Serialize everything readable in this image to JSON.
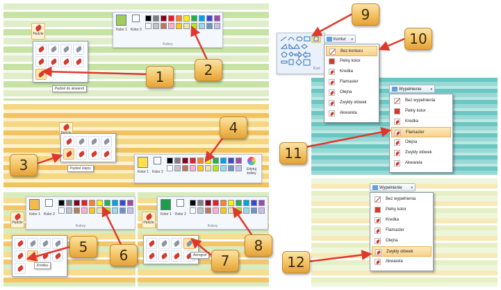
{
  "panel1": {
    "brushes_label": "Pędzle",
    "tooltip": "Pędzel do akwareli",
    "color1_label": "Kolor 1",
    "color2_label": "Kolor 2",
    "colors_group_label": "Kolory"
  },
  "panel2": {
    "brushes_label": "Pędzle",
    "tooltip": "Pędzel olejny",
    "color1_label": "Kolor 1",
    "color2_label": "Kolor 2",
    "edit_colors_label": "Edytuj kolory"
  },
  "panel3": {
    "brushes_label": "Pędzle",
    "tooltip": "Kredka",
    "color1_label": "Kolor 1",
    "color2_label": "Kolor 2",
    "colors_group_label": "Kolory"
  },
  "panel4": {
    "brushes_label": "Pędzle",
    "tooltip": "Aerograf",
    "color1_label": "Kolor 1",
    "color2_label": "Kolor 2",
    "colors_group_label": "Kolory"
  },
  "shapes_panel": {
    "group_label": "Kszt"
  },
  "outline_menu": {
    "button_label": "Kontur",
    "items": [
      "Bez konturu",
      "Pełny kolor",
      "Kredka",
      "Flamaster",
      "Olejna",
      "Zwykły ołówek",
      "Akwarela"
    ]
  },
  "fill_menu_1": {
    "button_label": "Wypełnienie",
    "items": [
      "Bez wypełnienia",
      "Pełny kolor",
      "Kredka",
      "Flamaster",
      "Olejna",
      "Zwykły ołówek",
      "Akwarela"
    ]
  },
  "fill_menu_2": {
    "button_label": "Wypełnienie",
    "items": [
      "Bez wypełnienia",
      "Pełny kolor",
      "Kredka",
      "Flamaster",
      "Olejna",
      "Zwykły ołówek",
      "Akwarela"
    ]
  },
  "callouts": [
    "1",
    "2",
    "3",
    "4",
    "5",
    "6",
    "7",
    "8",
    "9",
    "10",
    "11",
    "12"
  ],
  "colors": {
    "arrow": "#e0362b",
    "badge": "#f3c160",
    "highlight": "#f8d28a",
    "swatches": [
      "#000000",
      "#7f7f7f",
      "#880015",
      "#ed1c24",
      "#ff7f27",
      "#fff200",
      "#22b14c",
      "#00a2e8",
      "#3f48cc",
      "#a349a4",
      "#ffffff",
      "#c3c3c3",
      "#b97a57",
      "#ffaec9",
      "#ffc90e",
      "#efe4b0",
      "#b5e61d",
      "#99d9ea",
      "#7092be",
      "#c8bfe7"
    ]
  }
}
